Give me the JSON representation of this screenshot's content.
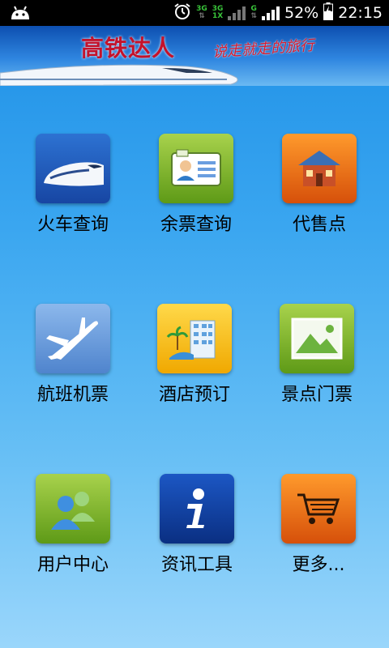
{
  "status_bar": {
    "network1": "3G",
    "network2_top": "3G",
    "network2_bottom": "1X",
    "network3": "G",
    "battery_percent": "52%",
    "time": "22:15",
    "icons": [
      "android-icon",
      "alarm-icon",
      "signal-icon",
      "battery-icon"
    ]
  },
  "header": {
    "title": "高铁达人",
    "slogan": "说走就走的旅行"
  },
  "grid": {
    "items": [
      {
        "label": "火车查询",
        "icon": "train-icon"
      },
      {
        "label": "余票查询",
        "icon": "ticket-card-icon"
      },
      {
        "label": "代售点",
        "icon": "house-icon"
      },
      {
        "label": "航班机票",
        "icon": "airplane-icon"
      },
      {
        "label": "酒店预订",
        "icon": "hotel-icon"
      },
      {
        "label": "景点门票",
        "icon": "landscape-picture-icon"
      },
      {
        "label": "用户中心",
        "icon": "users-icon"
      },
      {
        "label": "资讯工具",
        "icon": "info-icon"
      },
      {
        "label": "更多...",
        "icon": "shopping-cart-icon"
      }
    ]
  },
  "colors": {
    "title_red": "#c4122b",
    "background_top": "#1d8fe6",
    "background_bottom": "#9ad6fb"
  }
}
